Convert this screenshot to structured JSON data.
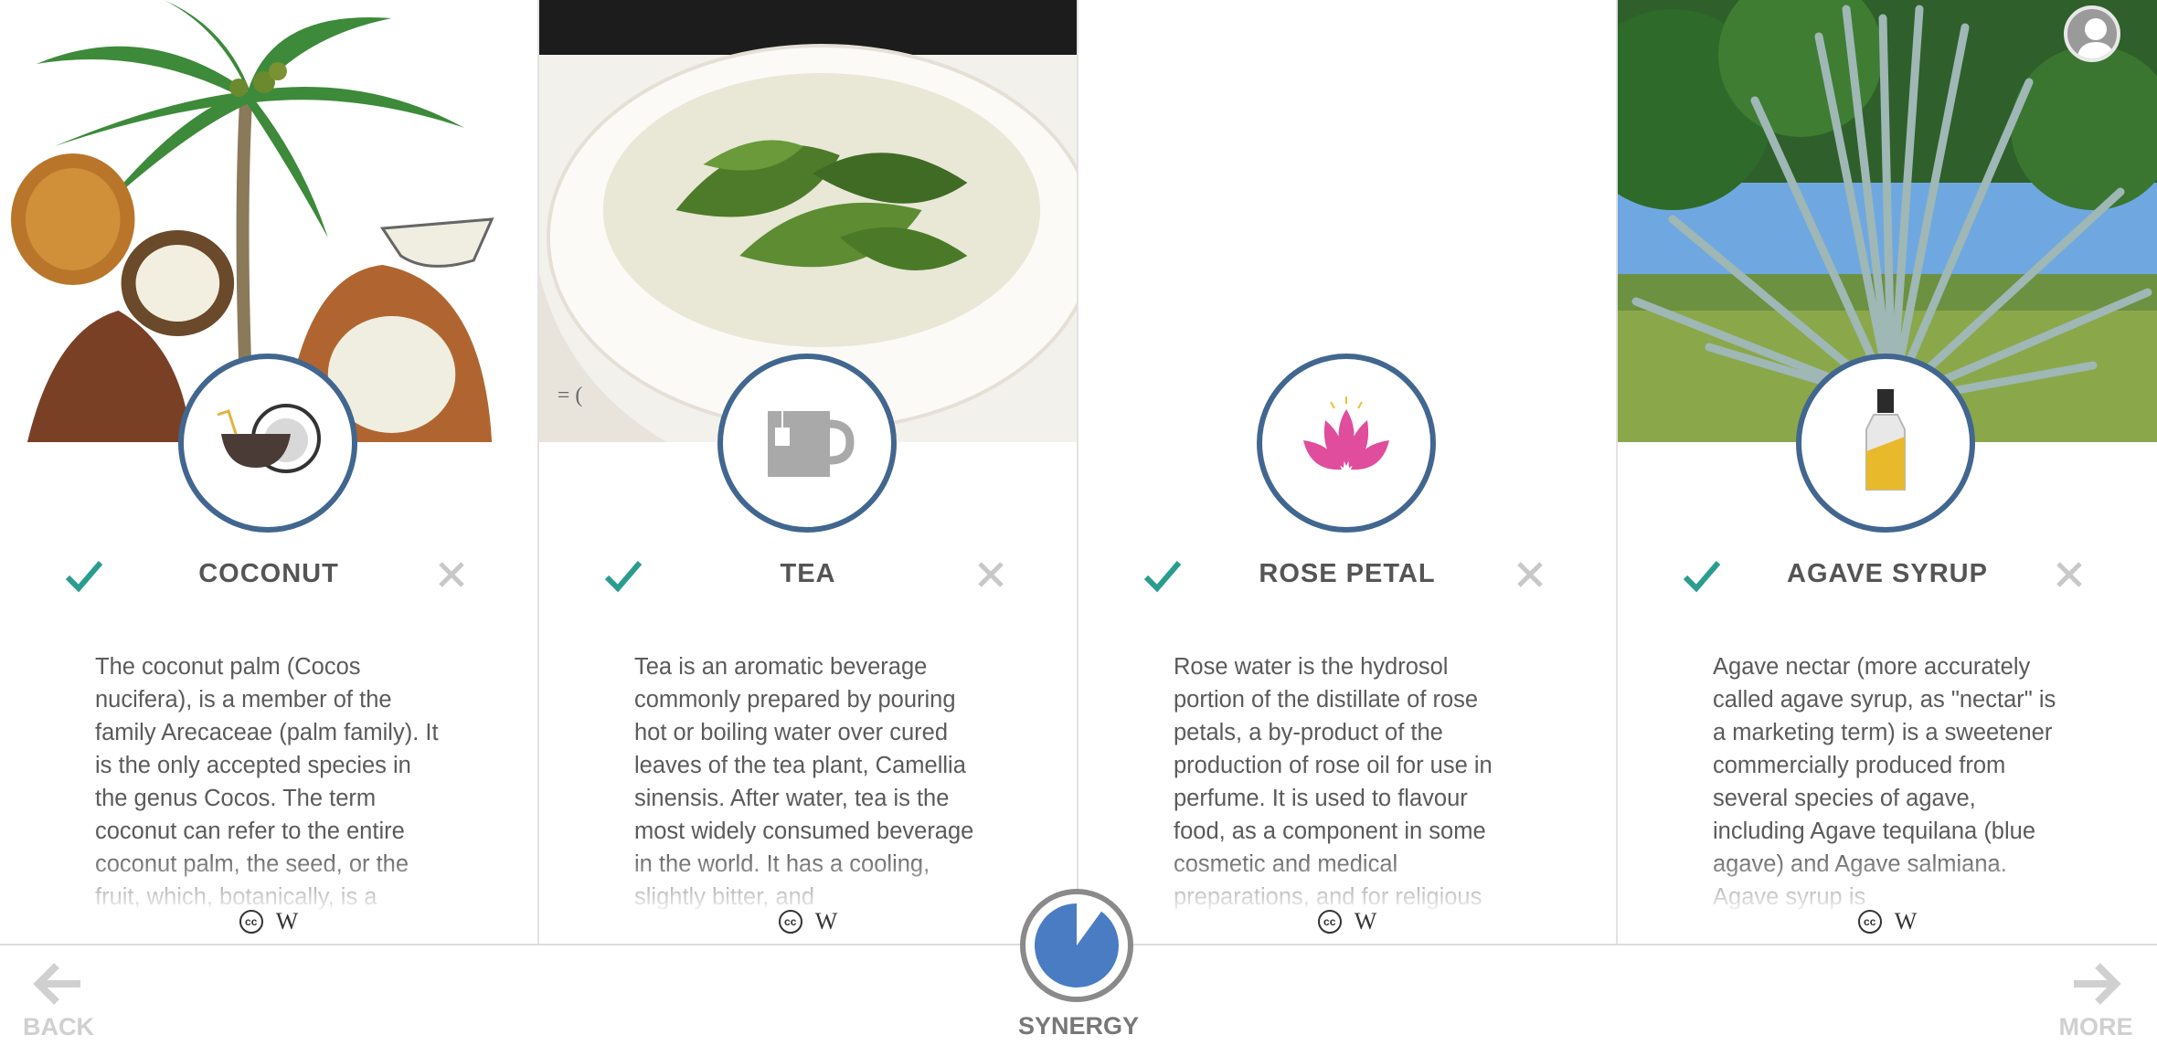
{
  "cards": [
    {
      "title": "COCONUT",
      "description": "The coconut palm (Cocos nucifera), is a member of the family Arecaceae (palm family). It is the only accepted species in the genus Cocos. The term coconut can refer to the entire coconut palm, the seed, or the fruit, which, botanically, is a",
      "icon": "coconut-icon"
    },
    {
      "title": "TEA",
      "description": "Tea is an aromatic beverage commonly prepared by pouring hot or boiling water over cured leaves of the tea plant, Camellia sinensis. After water, tea is the most widely consumed beverage in the world. It has a cooling, slightly bitter, and",
      "icon": "tea-mug-icon"
    },
    {
      "title": "ROSE PETAL",
      "description": "Rose water is the hydrosol portion of the distillate of rose petals, a by-product of the production of rose oil for use in perfume. It is used to flavour food, as a component in some cosmetic and medical preparations, and for religious",
      "icon": "lotus-icon"
    },
    {
      "title": "AGAVE SYRUP",
      "description": "Agave nectar (more accurately called agave syrup, as \"nectar\" is a marketing term) is a sweetener commercially produced from several species of agave, including Agave tequilana (blue agave) and Agave salmiana. Agave syrup is",
      "icon": "syrup-bottle-icon"
    }
  ],
  "credits": {
    "cc": "cc",
    "wiki": "W"
  },
  "footer": {
    "back": "BACK",
    "more": "MORE",
    "synergy": "SYNERGY",
    "synergy_fraction": 0.9
  },
  "colors": {
    "ring": "#41668f",
    "check": "#2a9d8f",
    "close": "#c8c8c8",
    "synergy": "#4a7cc4",
    "lotus": "#e04d9c",
    "syrup": "#e8b92a"
  }
}
